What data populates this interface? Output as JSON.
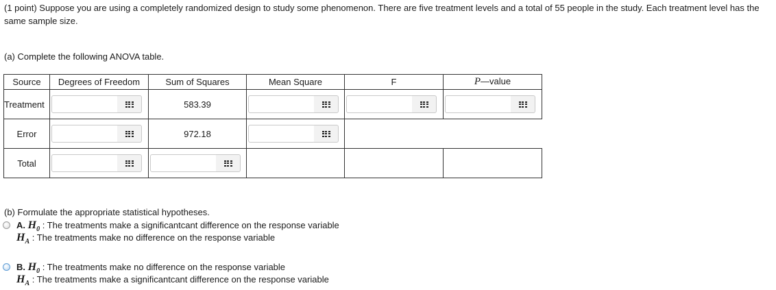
{
  "intro": "(1 point) Suppose you are using a completely randomized design to study some phenomenon. There are five treatment levels and a total of 55 people in the study. Each treatment level has the same sample size.",
  "part_a": "(a) Complete the following ANOVA table.",
  "table": {
    "headers": {
      "source": "Source",
      "df": "Degrees of Freedom",
      "ss": "Sum of Squares",
      "ms": "Mean Square",
      "f": "F",
      "p_symbol": "P",
      "p_rest": "—value"
    },
    "rows": {
      "treatment": {
        "label": "Treatment",
        "ss": "583.39"
      },
      "error": {
        "label": "Error",
        "ss": "972.18"
      },
      "total": {
        "label": "Total"
      }
    }
  },
  "part_b": "(b) Formulate the appropriate statistical hypotheses.",
  "options": {
    "a": {
      "letter": "A.",
      "h0_symbol": "H",
      "h0_sub": "0",
      "h0_text": " : The treatments make a significantcant difference on the response variable",
      "ha_symbol": "H",
      "ha_sub": "A",
      "ha_text": " : The treatments make no difference on the response variable"
    },
    "b": {
      "letter": "B.",
      "h0_symbol": "H",
      "h0_sub": "0",
      "h0_text": " : The treatments make no difference on the response variable",
      "ha_symbol": "H",
      "ha_sub": "A",
      "ha_text": " : The treatments make a significantcant difference on the response variable"
    }
  },
  "colors": {
    "radio_default": "#9a9a9a",
    "radio_b": "#5b9bd5"
  }
}
